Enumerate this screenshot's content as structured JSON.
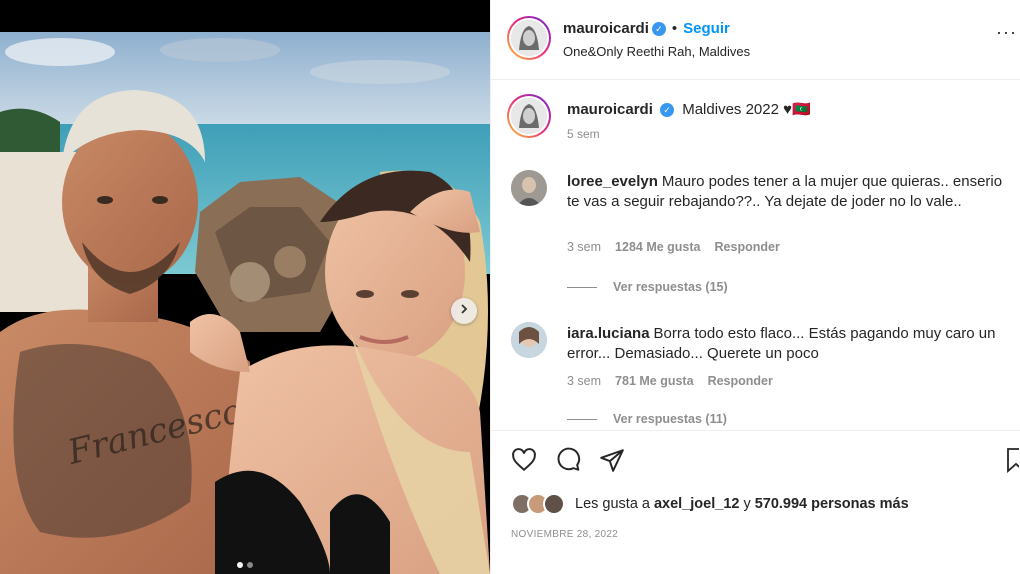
{
  "post": {
    "username": "mauroicardi",
    "follow_label": "Seguir",
    "bullet": "•",
    "location": "One&Only Reethi Rah, Maldives",
    "more_label": "···"
  },
  "caption": {
    "username": "mauroicardi",
    "text": "Maldives 2022 ♥︎🇲🇻",
    "time": "5 sem"
  },
  "comments": [
    {
      "username": "loree_evelyn",
      "text": "Mauro podes tener a la mujer que quieras.. enserio te vas a seguir rebajando??.. Ya dejate de joder no lo vale..",
      "time": "3 sem",
      "likes": "1284 Me gusta",
      "reply_label": "Responder",
      "view_replies": "Ver respuestas (15)"
    },
    {
      "username": "iara.luciana",
      "text": "Borra todo esto flaco... Estás pagando muy caro un error... Demasiado... Querete un poco",
      "time": "3 sem",
      "likes": "781 Me gusta",
      "reply_label": "Responder",
      "view_replies": "Ver respuestas (11)"
    }
  ],
  "likes_line": {
    "prefix": "Les gusta a",
    "user": "axel_joel_12",
    "middle": "y",
    "count": "570.994 personas más"
  },
  "date": "NOVIEMBRE 28, 2022",
  "colors": {
    "accent": "#0095f6",
    "verified": "#3897f0",
    "muted": "#8e8e8e"
  },
  "icons": [
    "heart-icon",
    "comment-icon",
    "share-icon",
    "bookmark-icon",
    "chevron-right-icon",
    "verified-icon"
  ]
}
